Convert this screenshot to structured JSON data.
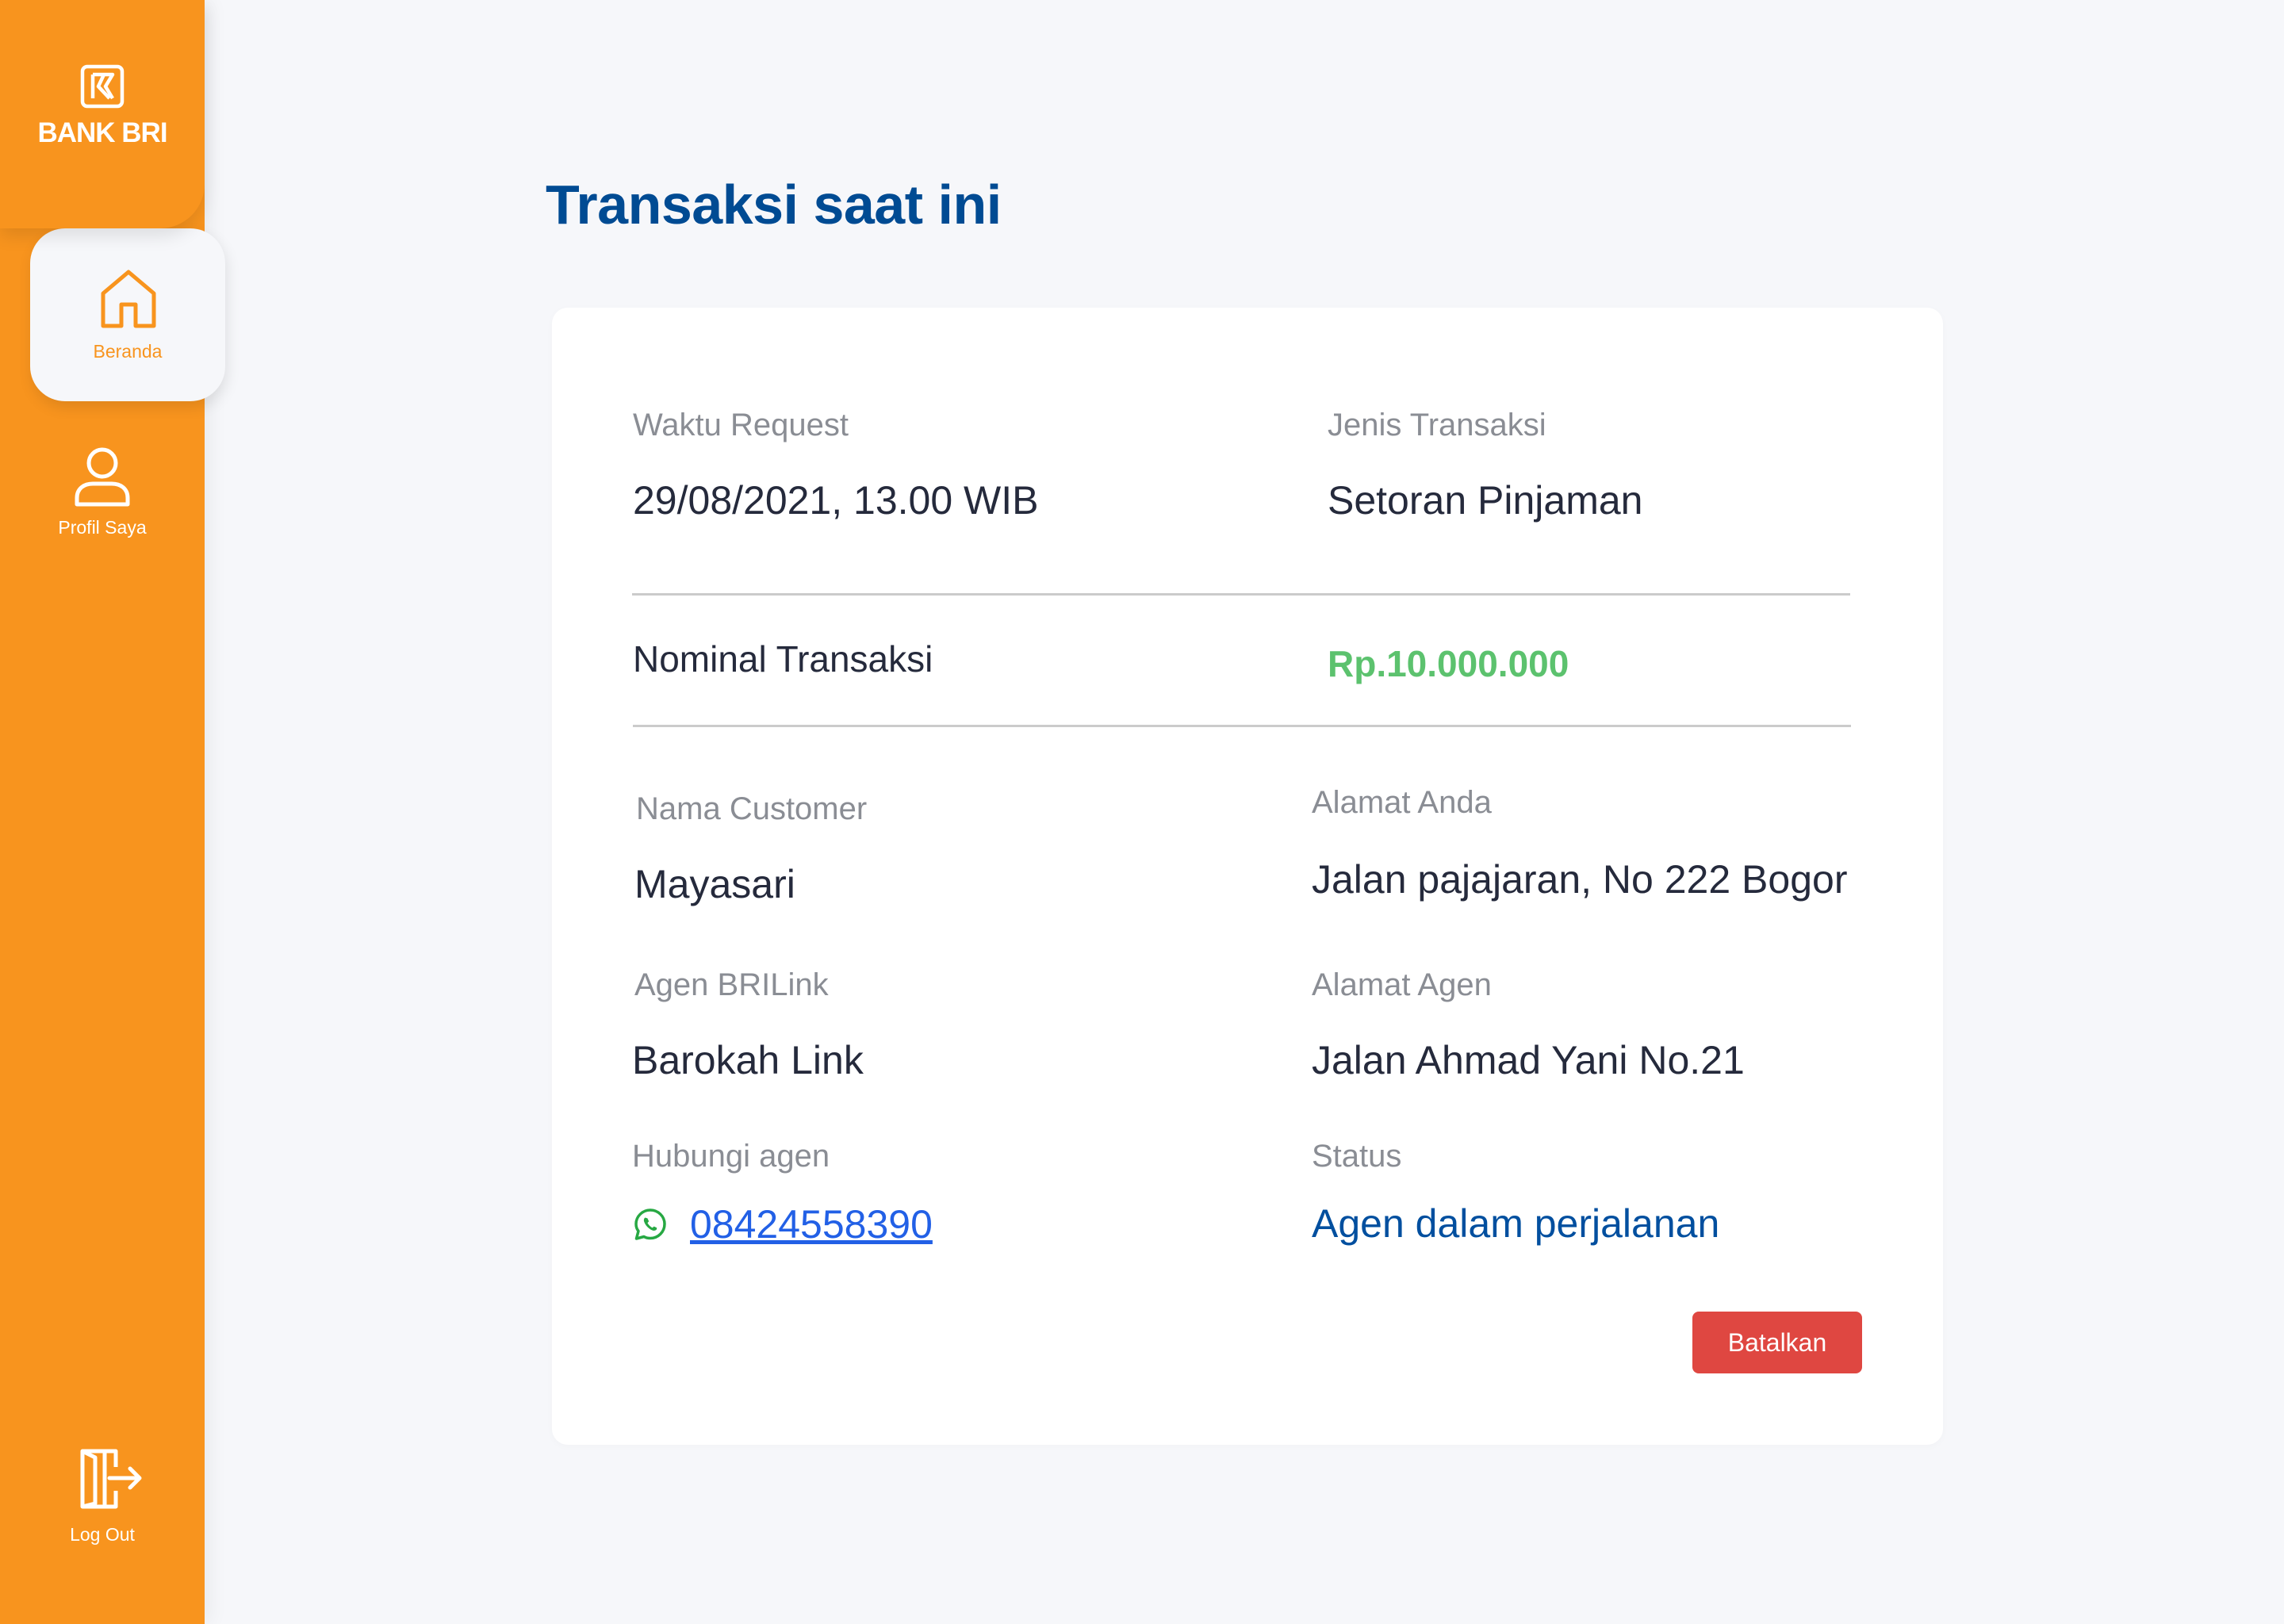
{
  "brand": {
    "name": "BANK BRI",
    "accent": "#F8941E"
  },
  "sidebar": {
    "items": [
      {
        "label": "Beranda",
        "icon": "home-icon",
        "active": true
      },
      {
        "label": "Profil Saya",
        "icon": "user-icon",
        "active": false
      }
    ],
    "logout": {
      "label": "Log Out",
      "icon": "logout-icon"
    }
  },
  "page": {
    "title": "Transaksi saat ini"
  },
  "transaction": {
    "request_time": {
      "label": "Waktu Request",
      "value": "29/08/2021, 13.00 WIB"
    },
    "type": {
      "label": "Jenis Transaksi",
      "value": "Setoran Pinjaman"
    },
    "amount": {
      "label": "Nominal Transaksi",
      "value": "Rp.10.000.000",
      "color": "#5CC26E"
    },
    "customer": {
      "label": "Nama Customer",
      "value": "Mayasari"
    },
    "your_address": {
      "label": "Alamat Anda",
      "value": "Jalan pajajaran, No 222 Bogor"
    },
    "agent": {
      "label": "Agen BRILink",
      "value": "Barokah Link"
    },
    "agent_address": {
      "label": "Alamat Agen",
      "value": "Jalan Ahmad Yani No.21"
    },
    "contact": {
      "label": "Hubungi agen",
      "value": "08424558390",
      "icon": "whatsapp-icon"
    },
    "status": {
      "label": "Status",
      "value": "Agen dalam perjalanan",
      "color": "#014F9F"
    }
  },
  "actions": {
    "cancel_label": "Batalkan",
    "cancel_color": "#DF4741"
  }
}
